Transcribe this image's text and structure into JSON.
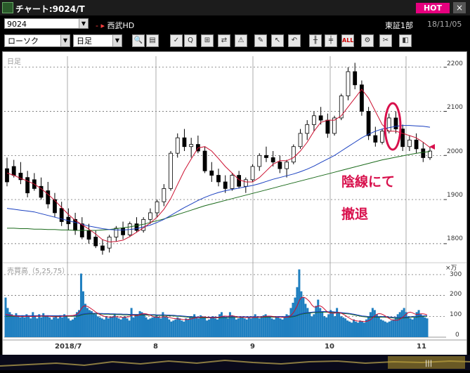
{
  "window": {
    "title": "チャート:9024/T",
    "hot_label": "HOT",
    "close_glyph": "×"
  },
  "header": {
    "code": "9024",
    "arrow": "- ▸",
    "stock_name": "西武HD",
    "market": "東証1部",
    "date": "18/11/05"
  },
  "toolbar": {
    "chart_type": "ローソク",
    "period": "日足",
    "tools": [
      "zoom-icon",
      "layout-icon",
      "mark-icon",
      "search-icon",
      "scale-icon",
      "compare-icon",
      "alert-icon",
      "pen-icon",
      "cursor-icon",
      "undo-icon",
      "candle-icon",
      "candle2-icon",
      "all-icon",
      "settings-icon",
      "tool-icon",
      "palette-icon"
    ],
    "all_label": "ALL"
  },
  "chart": {
    "period_label": "日足",
    "volume_label": "売買高（5,25,75）",
    "volume_unit": "×万",
    "y_labels": [
      "2200",
      "2100",
      "2000",
      "1900",
      "1800"
    ],
    "vol_labels": [
      "300",
      "200",
      "100",
      "0"
    ],
    "x_labels": [
      "2018/7",
      "8",
      "9",
      "10",
      "11"
    ],
    "annotation_line1": "陰線にて",
    "annotation_line2": "撤退"
  },
  "colors": {
    "ma5": "#cc1030",
    "ma25": "#1a40c0",
    "ma75": "#1a6a1a",
    "volume": "#1f7fc0",
    "annotation": "#d8104c"
  },
  "chart_data": {
    "type": "candlestick",
    "ylim": [
      1760,
      2225
    ],
    "volume_ylim": [
      0,
      320
    ],
    "candles": [
      [
        1970,
        1995,
        1930,
        1940
      ],
      [
        1975,
        1990,
        1950,
        1955
      ],
      [
        1960,
        1985,
        1935,
        1945
      ],
      [
        1950,
        1965,
        1905,
        1915
      ],
      [
        1945,
        1960,
        1920,
        1925
      ],
      [
        1930,
        1950,
        1900,
        1905
      ],
      [
        1920,
        1940,
        1880,
        1890
      ],
      [
        1900,
        1915,
        1860,
        1870
      ],
      [
        1880,
        1895,
        1840,
        1850
      ],
      [
        1860,
        1880,
        1830,
        1845
      ],
      [
        1855,
        1870,
        1820,
        1830
      ],
      [
        1845,
        1860,
        1810,
        1815
      ],
      [
        1830,
        1845,
        1800,
        1810
      ],
      [
        1815,
        1830,
        1790,
        1795
      ],
      [
        1795,
        1810,
        1775,
        1785
      ],
      [
        1790,
        1820,
        1780,
        1815
      ],
      [
        1815,
        1840,
        1805,
        1835
      ],
      [
        1835,
        1850,
        1810,
        1820
      ],
      [
        1820,
        1850,
        1815,
        1845
      ],
      [
        1845,
        1860,
        1825,
        1830
      ],
      [
        1830,
        1860,
        1825,
        1855
      ],
      [
        1855,
        1880,
        1845,
        1870
      ],
      [
        1870,
        1900,
        1860,
        1895
      ],
      [
        1895,
        1935,
        1885,
        1925
      ],
      [
        1925,
        2010,
        1920,
        2005
      ],
      [
        2005,
        2050,
        1995,
        2040
      ],
      [
        2040,
        2060,
        2010,
        2020
      ],
      [
        2020,
        2040,
        1995,
        2025
      ],
      [
        2025,
        2045,
        2005,
        2010
      ],
      [
        2010,
        2020,
        1960,
        1965
      ],
      [
        1965,
        1985,
        1940,
        1955
      ],
      [
        1955,
        1970,
        1930,
        1940
      ],
      [
        1940,
        1955,
        1915,
        1925
      ],
      [
        1925,
        1960,
        1920,
        1955
      ],
      [
        1955,
        1965,
        1925,
        1930
      ],
      [
        1930,
        1950,
        1915,
        1945
      ],
      [
        1945,
        1980,
        1940,
        1975
      ],
      [
        1975,
        2005,
        1965,
        2000
      ],
      [
        2000,
        2020,
        1985,
        1995
      ],
      [
        1995,
        2010,
        1975,
        1985
      ],
      [
        1985,
        2000,
        1960,
        1970
      ],
      [
        1970,
        1990,
        1950,
        1985
      ],
      [
        1985,
        2025,
        1980,
        2020
      ],
      [
        2020,
        2060,
        2015,
        2050
      ],
      [
        2050,
        2080,
        2035,
        2070
      ],
      [
        2070,
        2100,
        2055,
        2090
      ],
      [
        2090,
        2110,
        2070,
        2080
      ],
      [
        2080,
        2095,
        2040,
        2050
      ],
      [
        2050,
        2090,
        2045,
        2085
      ],
      [
        2085,
        2140,
        2080,
        2135
      ],
      [
        2135,
        2200,
        2125,
        2190
      ],
      [
        2190,
        2210,
        2150,
        2160
      ],
      [
        2160,
        2170,
        2090,
        2100
      ],
      [
        2100,
        2110,
        2035,
        2045
      ],
      [
        2045,
        2065,
        2020,
        2030
      ],
      [
        2030,
        2060,
        2025,
        2055
      ],
      [
        2055,
        2095,
        2050,
        2085
      ],
      [
        2085,
        2100,
        2050,
        2060
      ],
      [
        2060,
        2070,
        2010,
        2020
      ],
      [
        2020,
        2045,
        2010,
        2035
      ],
      [
        2035,
        2050,
        2005,
        2015
      ],
      [
        2015,
        2030,
        1985,
        1995
      ],
      [
        1995,
        2020,
        1990,
        2010
      ]
    ],
    "ma5": [
      1960,
      1955,
      1948,
      1942,
      1935,
      1925,
      1912,
      1898,
      1882,
      1866,
      1853,
      1843,
      1833,
      1822,
      1809,
      1804,
      1805,
      1808,
      1816,
      1826,
      1836,
      1847,
      1860,
      1878,
      1902,
      1934,
      1966,
      1992,
      2017,
      2020,
      2010,
      1993,
      1975,
      1960,
      1945,
      1940,
      1940,
      1950,
      1965,
      1980,
      1988,
      1988,
      1995,
      2010,
      2030,
      2055,
      2075,
      2080,
      2080,
      2090,
      2110,
      2130,
      2150,
      2130,
      2100,
      2070,
      2055,
      2055,
      2050,
      2045,
      2040,
      2030,
      2018
    ],
    "ma25": [
      1880,
      1878,
      1876,
      1874,
      1872,
      1868,
      1864,
      1860,
      1856,
      1852,
      1848,
      1844,
      1840,
      1837,
      1834,
      1832,
      1831,
      1831,
      1832,
      1834,
      1838,
      1842,
      1848,
      1855,
      1864,
      1873,
      1882,
      1890,
      1898,
      1905,
      1911,
      1916,
      1920,
      1923,
      1926,
      1929,
      1932,
      1936,
      1941,
      1946,
      1950,
      1954,
      1958,
      1963,
      1969,
      1976,
      1984,
      1992,
      2000,
      2010,
      2020,
      2030,
      2040,
      2048,
      2055,
      2060,
      2063,
      2066,
      2068,
      2068,
      2067,
      2066,
      2064
    ],
    "ma75": [
      1835,
      1835,
      1834,
      1834,
      1833,
      1833,
      1832,
      1832,
      1831,
      1831,
      1830,
      1830,
      1830,
      1830,
      1831,
      1832,
      1834,
      1836,
      1838,
      1841,
      1844,
      1848,
      1852,
      1856,
      1861,
      1866,
      1871,
      1876,
      1881,
      1886,
      1890,
      1894,
      1898,
      1902,
      1906,
      1910,
      1914,
      1918,
      1922,
      1926,
      1930,
      1934,
      1938,
      1942,
      1946,
      1950,
      1954,
      1958,
      1962,
      1966,
      1970,
      1974,
      1978,
      1982,
      1986,
      1990,
      1993,
      1996,
      1999,
      2002,
      2005,
      2007,
      2009
    ],
    "volume": [
      190,
      140,
      120,
      110,
      100,
      115,
      105,
      95,
      105,
      95,
      110,
      100,
      90,
      120,
      100,
      90,
      110,
      95,
      115,
      100,
      105,
      95,
      85,
      95,
      100,
      90,
      105,
      95,
      110,
      100,
      90,
      80,
      85,
      95,
      120,
      130,
      305,
      220,
      160,
      140,
      130,
      125,
      115,
      110,
      100,
      95,
      90,
      85,
      100,
      90,
      95,
      100,
      110,
      95,
      90,
      85,
      95,
      100,
      90,
      80,
      140,
      95,
      105,
      110,
      125,
      120,
      105,
      95,
      85,
      90,
      95,
      100,
      105,
      95,
      90,
      120,
      100,
      95,
      85,
      75,
      80,
      85,
      95,
      90,
      80,
      75,
      90,
      85,
      95,
      100,
      110,
      95,
      90,
      105,
      100,
      95,
      80,
      85,
      95,
      100,
      90,
      85,
      110,
      120,
      100,
      95,
      90,
      120,
      105,
      95,
      85,
      90,
      95,
      100,
      90,
      85,
      95,
      90,
      100,
      110,
      95,
      90,
      100,
      105,
      110,
      100,
      95,
      90,
      85,
      95,
      100,
      90,
      85,
      95,
      110,
      105,
      140,
      165,
      190,
      240,
      325,
      220,
      190,
      160,
      140,
      120,
      100,
      110,
      150,
      180,
      140,
      120,
      100,
      95,
      110,
      130,
      120,
      100,
      140,
      120,
      100,
      95,
      90,
      80,
      75,
      70,
      85,
      75,
      70,
      80,
      75,
      70,
      85,
      95,
      120,
      140,
      130,
      110,
      95,
      85,
      80,
      75,
      70,
      75,
      80,
      85,
      95,
      110,
      120,
      130,
      140,
      120,
      100,
      90,
      85,
      95,
      120,
      130,
      110,
      100,
      95,
      90
    ],
    "volume_ma1": [
      110,
      108,
      106,
      104,
      102,
      101,
      100,
      99,
      99,
      99,
      100,
      100,
      99,
      99,
      100,
      100,
      100,
      101,
      101,
      101,
      100,
      100,
      99,
      98,
      98,
      98,
      99,
      100,
      101,
      102,
      102,
      103,
      104,
      106,
      110,
      118,
      135,
      148,
      150,
      148,
      142,
      135,
      128,
      120,
      114,
      108,
      104,
      100,
      98,
      97,
      96,
      97,
      98,
      98,
      97,
      96,
      95,
      96,
      97,
      98,
      105,
      105,
      103,
      104,
      108,
      112,
      113,
      112,
      109,
      105,
      100,
      97,
      96,
      96,
      95,
      98,
      98,
      97,
      95,
      92,
      90,
      89,
      88,
      87,
      86,
      84,
      85,
      85,
      87,
      89,
      92,
      94,
      94,
      96,
      97,
      97,
      95,
      94,
      93,
      94,
      94,
      94,
      96,
      99,
      101,
      101,
      100,
      102,
      102,
      101,
      98,
      96,
      96,
      96,
      95,
      94,
      94,
      94,
      95,
      96,
      96,
      96,
      97,
      98,
      100,
      101,
      101,
      100,
      98,
      97,
      96,
      96,
      95,
      95,
      96,
      97,
      104,
      115,
      130,
      150,
      175,
      190,
      192,
      188,
      180,
      170,
      155,
      145,
      145,
      150,
      150,
      145,
      135,
      125,
      118,
      116,
      116,
      115,
      118,
      118,
      115,
      110,
      104,
      97,
      91,
      85,
      82,
      79,
      77,
      77,
      76,
      75,
      76,
      78,
      84,
      93,
      103,
      110,
      113,
      112,
      108,
      102,
      95,
      89,
      84,
      82,
      81,
      82,
      86,
      93,
      101,
      110,
      118,
      120,
      117,
      112,
      109,
      110,
      112,
      112,
      110,
      107
    ],
    "volume_ma2": [
      100,
      100,
      100,
      100,
      100,
      100,
      100,
      100,
      100,
      100,
      100,
      100,
      100,
      100,
      100,
      100,
      100,
      100,
      100,
      100,
      100,
      100,
      100,
      100,
      100,
      100,
      100,
      100,
      100,
      100,
      100,
      100,
      100,
      100,
      101,
      102,
      106,
      108,
      110,
      111,
      112,
      112,
      112,
      112,
      112,
      111,
      111,
      110,
      110,
      110,
      109,
      109,
      109,
      108,
      108,
      108,
      107,
      107,
      107,
      106,
      106,
      106,
      106,
      106,
      106,
      106,
      106,
      106,
      105,
      105,
      105,
      105,
      104,
      104,
      104,
      104,
      104,
      103,
      103,
      102,
      102,
      101,
      100,
      100,
      99,
      98,
      97,
      96,
      96,
      95,
      95,
      94,
      94,
      93,
      93,
      93,
      93,
      93,
      93,
      93,
      93,
      93,
      93,
      94,
      94,
      94,
      94,
      95,
      95,
      95,
      95,
      95,
      95,
      95,
      95,
      95,
      95,
      95,
      95,
      95,
      95,
      95,
      95,
      96,
      96,
      96,
      96,
      96,
      96,
      96,
      96,
      96,
      96,
      96,
      96,
      96,
      97,
      98,
      100,
      103,
      107,
      110,
      112,
      114,
      115,
      116,
      117,
      118,
      118,
      119,
      119,
      120,
      120,
      120,
      119,
      119,
      119,
      118,
      117,
      116,
      115,
      114,
      113,
      112,
      111,
      109,
      107,
      105,
      103,
      101,
      99,
      98,
      97,
      96,
      96,
      96,
      96,
      96,
      96,
      96,
      96,
      95,
      95,
      94,
      93,
      92,
      92,
      91,
      91,
      92,
      92,
      93,
      94,
      95,
      96,
      97,
      97,
      98,
      99,
      99,
      100,
      100
    ]
  }
}
